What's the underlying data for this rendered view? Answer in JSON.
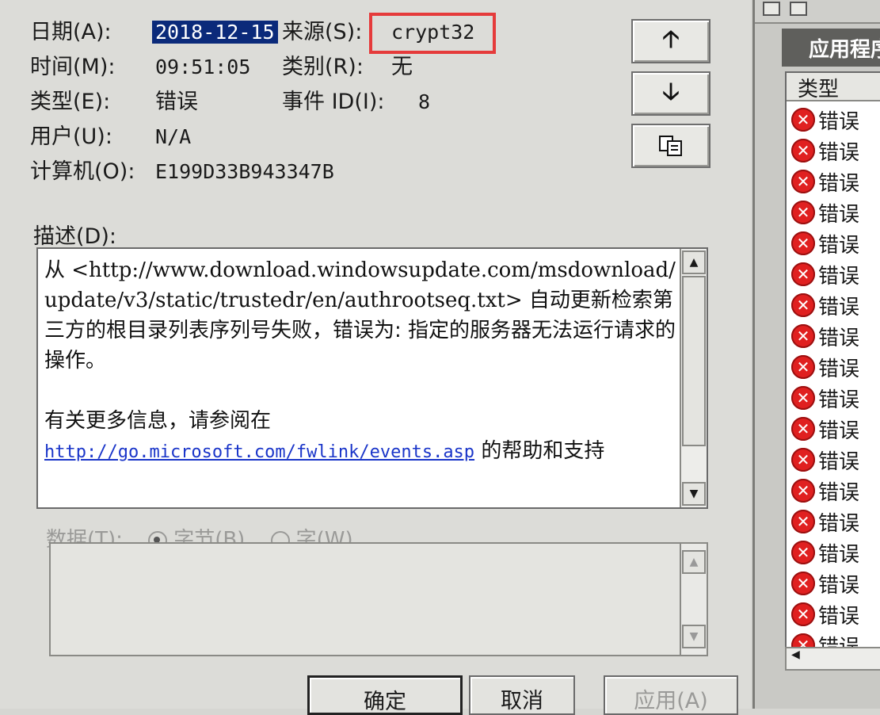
{
  "labels": {
    "date": "日期(A):",
    "time": "时间(M):",
    "type": "类型(E):",
    "user": "用户(U):",
    "computer": "计算机(O):",
    "source": "来源(S):",
    "category": "类别(R):",
    "event_id": "事件 ID(I):",
    "description": "描述(D):",
    "data": "数据(T):"
  },
  "values": {
    "date": "2018-12-15",
    "time": "09:51:05",
    "type": "错误",
    "user": "N/A",
    "computer": "E199D33B943347B",
    "source": "crypt32",
    "category": "无",
    "event_id": "8"
  },
  "description": {
    "line1_prefix": "从 ",
    "url_fetch": "<http://www.download.windowsupdate.com/msdownload/update/v3/static/trustedr/en/authrootseq.txt>",
    "line_text": " 自动更新检索第三方的根目录列表序列号失败，错误为: 指定的服务器无法运行请求的操作。",
    "more_info": "有关更多信息，请参阅在",
    "help_link": "http://go.microsoft.com/fwlink/events.asp",
    "help_suffix": " 的帮助和支持"
  },
  "data_format": {
    "bytes": "字节(B)",
    "words": "字(W)",
    "selected": "bytes"
  },
  "buttons": {
    "ok": "确定",
    "cancel": "取消",
    "apply": "应用(A)",
    "up_icon": "arrow-up",
    "down_icon": "arrow-down",
    "copy_icon": "copy"
  },
  "right_pane": {
    "title": "应用程序",
    "column_type": "类型",
    "rows": [
      "错误",
      "错误",
      "错误",
      "错误",
      "错误",
      "错误",
      "错误",
      "错误",
      "错误",
      "错误",
      "错误",
      "错误",
      "错误",
      "错误",
      "错误",
      "错误",
      "错误",
      "错误"
    ]
  },
  "colors": {
    "highlight": "#0b2a7a",
    "annotation_box": "#e53b3b",
    "error_icon": "#e02020",
    "link": "#1a35c9"
  }
}
